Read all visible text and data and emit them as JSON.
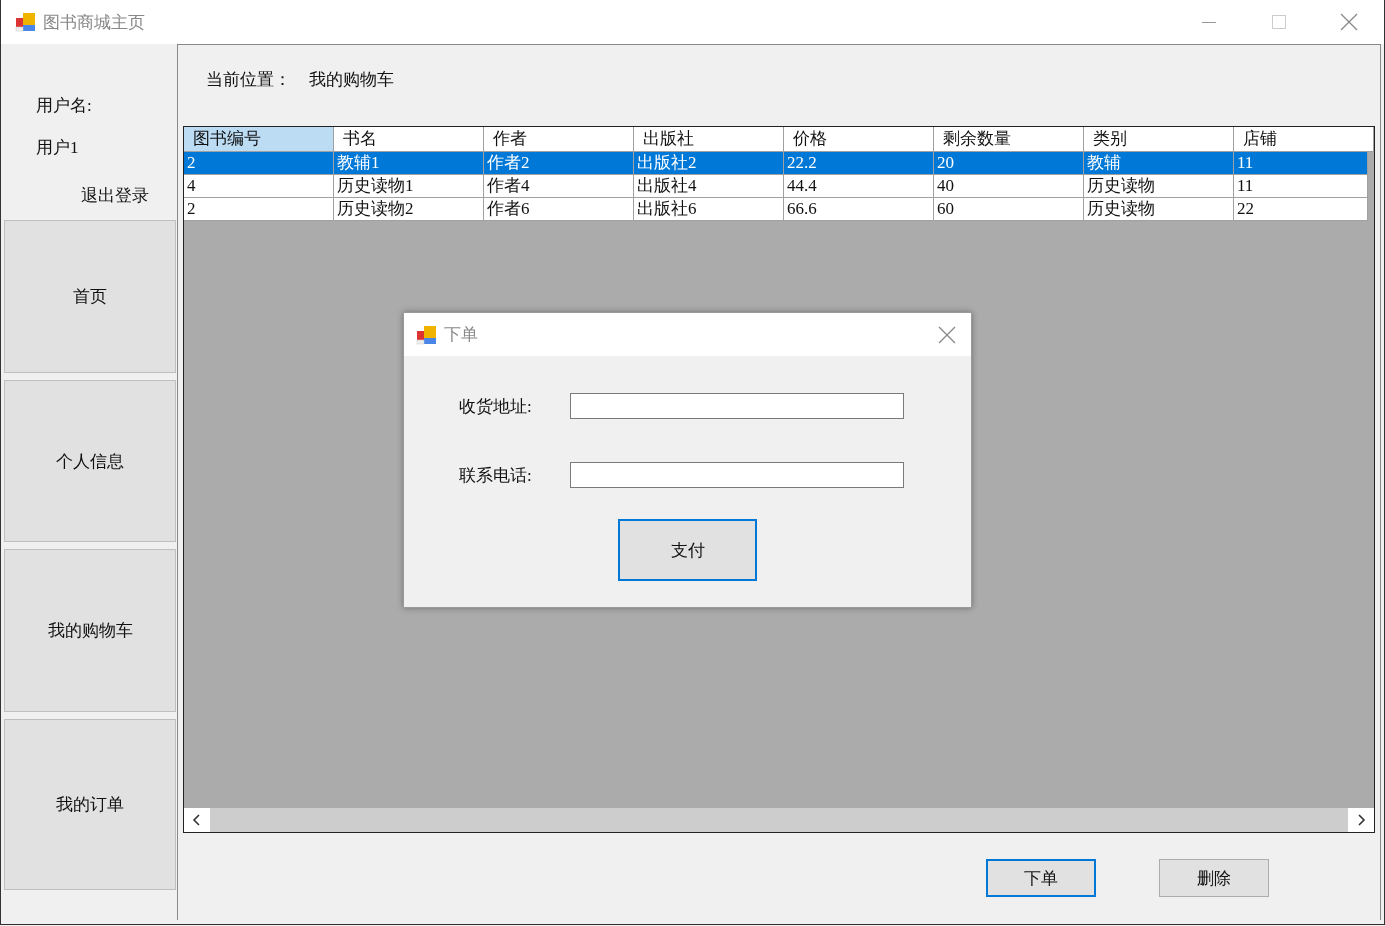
{
  "window": {
    "title": "图书商城主页"
  },
  "sidebar": {
    "user_label": "用户名:",
    "user_name": "用户1",
    "logout": "退出登录",
    "nav": [
      {
        "label": "首页",
        "selected": false
      },
      {
        "label": "个人信息",
        "selected": false
      },
      {
        "label": "我的购物车",
        "selected": false
      },
      {
        "label": "我的订单",
        "selected": false
      }
    ]
  },
  "location": {
    "label": "当前位置：",
    "value": "我的购物车"
  },
  "table": {
    "columns": [
      {
        "label": "图书编号",
        "selected": true
      },
      {
        "label": "书名",
        "selected": false
      },
      {
        "label": "作者",
        "selected": false
      },
      {
        "label": "出版社",
        "selected": false
      },
      {
        "label": "价格",
        "selected": false
      },
      {
        "label": "剩余数量",
        "selected": false
      },
      {
        "label": "类别",
        "selected": false
      },
      {
        "label": "店铺",
        "selected": false
      }
    ],
    "rows": [
      {
        "cells": [
          "2",
          "教辅1",
          "作者2",
          "出版社2",
          "22.2",
          "20",
          "教辅",
          "11"
        ],
        "selected": true
      },
      {
        "cells": [
          "4",
          "历史读物1",
          "作者4",
          "出版社4",
          "44.4",
          "40",
          "历史读物",
          "11"
        ],
        "selected": false
      },
      {
        "cells": [
          "2",
          "历史读物2",
          "作者6",
          "出版社6",
          "66.6",
          "60",
          "历史读物",
          "22"
        ],
        "selected": false
      }
    ]
  },
  "buttons": [
    {
      "label": "下单",
      "focused": true
    },
    {
      "label": "删除",
      "focused": false
    }
  ],
  "dialog": {
    "title": "下单",
    "fields": [
      {
        "label": "收货地址:"
      },
      {
        "label": "联系电话:"
      }
    ],
    "button": {
      "label": "支付",
      "focused": true
    }
  }
}
